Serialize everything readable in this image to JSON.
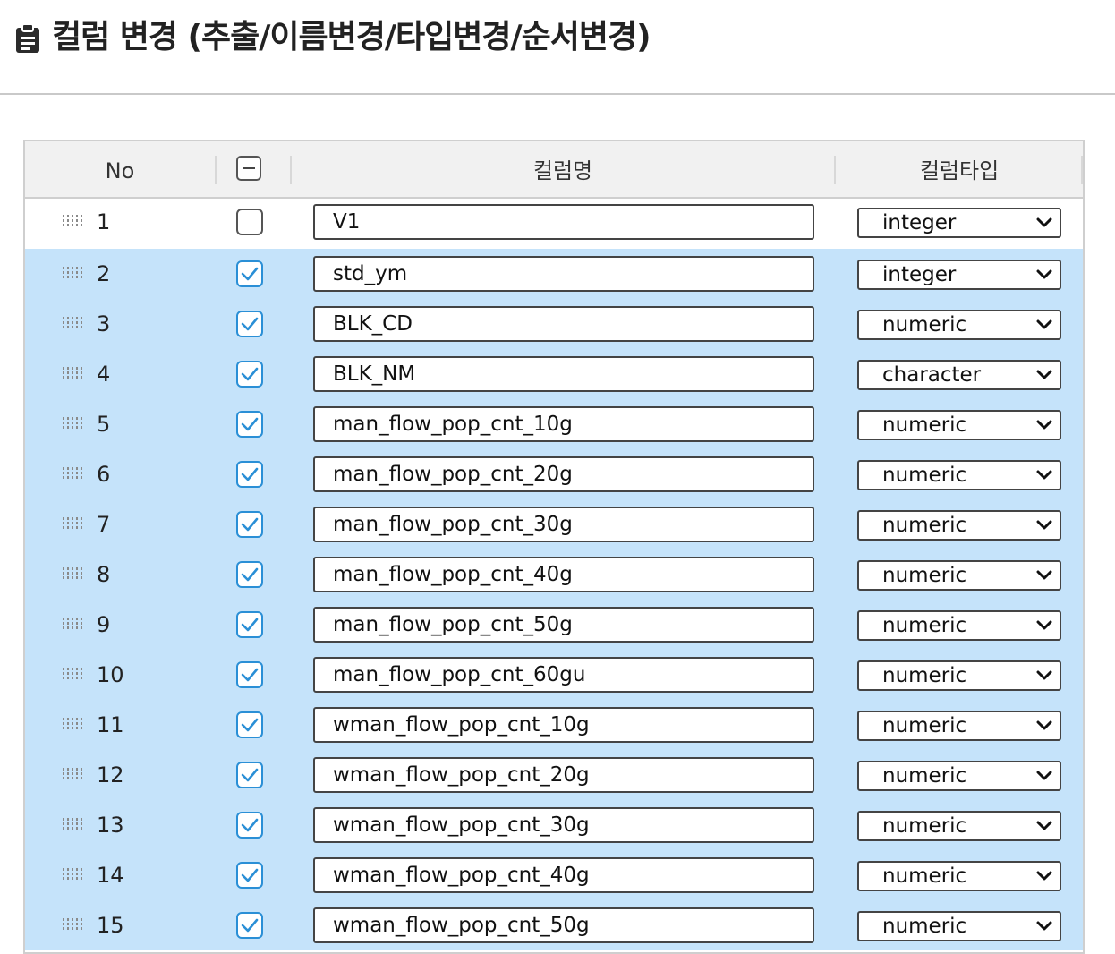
{
  "page": {
    "title": "컬럼 변경 (추출/이름변경/타입변경/순서변경)"
  },
  "grid": {
    "columns": {
      "no": "No",
      "name": "컬럼명",
      "type": "컬럼타입"
    },
    "header_checkbox_state": "indeterminate",
    "colors": {
      "selected_row": "#c5e3fa",
      "checked_accent": "#2a8fd6",
      "header_bg": "#f1f1f1"
    },
    "rows": [
      {
        "no": "1",
        "checked": false,
        "name": "V1",
        "type": "integer"
      },
      {
        "no": "2",
        "checked": true,
        "name": "std_ym",
        "type": "integer"
      },
      {
        "no": "3",
        "checked": true,
        "name": "BLK_CD",
        "type": "numeric"
      },
      {
        "no": "4",
        "checked": true,
        "name": "BLK_NM",
        "type": "character"
      },
      {
        "no": "5",
        "checked": true,
        "name": "man_flow_pop_cnt_10g",
        "type": "numeric"
      },
      {
        "no": "6",
        "checked": true,
        "name": "man_flow_pop_cnt_20g",
        "type": "numeric"
      },
      {
        "no": "7",
        "checked": true,
        "name": "man_flow_pop_cnt_30g",
        "type": "numeric"
      },
      {
        "no": "8",
        "checked": true,
        "name": "man_flow_pop_cnt_40g",
        "type": "numeric"
      },
      {
        "no": "9",
        "checked": true,
        "name": "man_flow_pop_cnt_50g",
        "type": "numeric"
      },
      {
        "no": "10",
        "checked": true,
        "name": "man_flow_pop_cnt_60gu",
        "type": "numeric"
      },
      {
        "no": "11",
        "checked": true,
        "name": "wman_flow_pop_cnt_10g",
        "type": "numeric"
      },
      {
        "no": "12",
        "checked": true,
        "name": "wman_flow_pop_cnt_20g",
        "type": "numeric"
      },
      {
        "no": "13",
        "checked": true,
        "name": "wman_flow_pop_cnt_30g",
        "type": "numeric"
      },
      {
        "no": "14",
        "checked": true,
        "name": "wman_flow_pop_cnt_40g",
        "type": "numeric"
      },
      {
        "no": "15",
        "checked": true,
        "name": "wman_flow_pop_cnt_50g",
        "type": "numeric"
      }
    ]
  }
}
